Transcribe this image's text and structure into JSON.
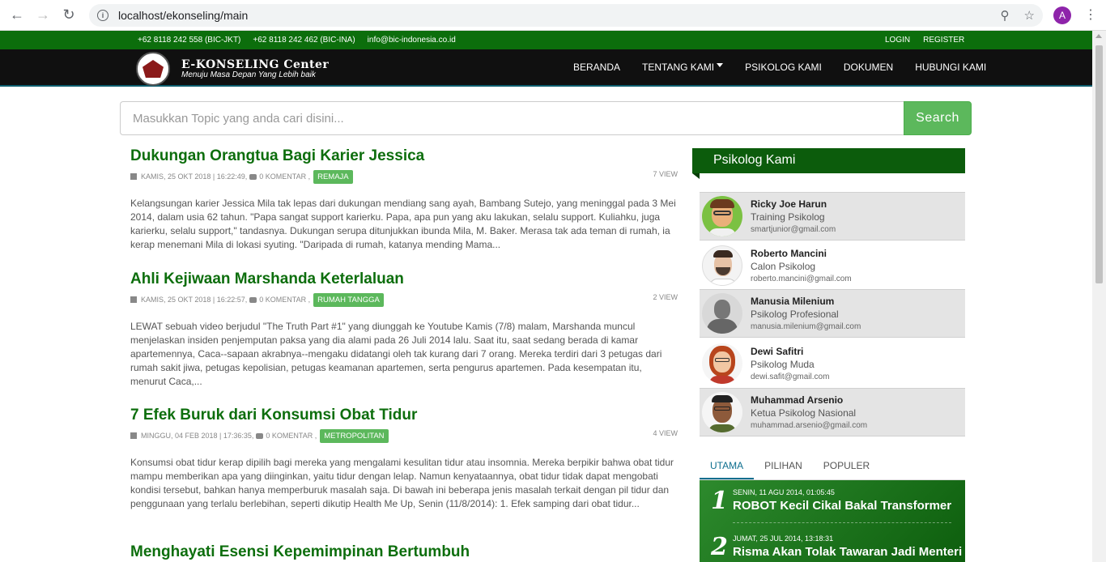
{
  "browser": {
    "url": "localhost/ekonseling/main",
    "avatar_letter": "A"
  },
  "topbar": {
    "contacts": [
      "+62 8118 242 558 (BIC-JKT)",
      "+62 8118 242 462 (BIC-INA)",
      "info@bic-indonesia.co.id"
    ],
    "login": "LOGIN",
    "register": "REGISTER"
  },
  "header": {
    "brand_title": "E-KONSELING Center",
    "brand_subtitle": "Menuju Masa Depan Yang Lebih baik",
    "nav": [
      "BERANDA",
      "TENTANG KAMI",
      "PSIKOLOG KAMI",
      "DOKUMEN",
      "HUBUNGI KAMI"
    ]
  },
  "search": {
    "placeholder": "Masukkan Topic yang anda cari disini...",
    "button": "Search"
  },
  "articles": [
    {
      "title": "Dukungan Orangtua Bagi Karier Jessica",
      "date": "KAMIS, 25 OKT 2018 | 16:22:49,",
      "comments": "0 KOMENTAR ,",
      "tag": "REMAJA",
      "views": "7 VIEW",
      "excerpt": "Kelangsungan karier Jessica Mila tak lepas dari dukungan mendiang sang ayah, Bambang Sutejo, yang meninggal pada 3 Mei 2014, dalam usia 62 tahun.  \"Papa sangat support karierku. Papa, apa pun yang aku lakukan, selalu support. Kuliahku, juga karierku, selalu support,\" tandasnya.  Dukungan serupa ditunjukkan ibunda Mila, M. Baker. Merasa tak ada teman di rumah, ia kerap menemani Mila di lokasi syuting.  \"Daripada di rumah, katanya mending Mama..."
    },
    {
      "title": "Ahli Kejiwaan Marshanda Keterlaluan",
      "date": "KAMIS, 25 OKT 2018 | 16:22:57,",
      "comments": "0 KOMENTAR ,",
      "tag": "RUMAH TANGGA",
      "views": "2 VIEW",
      "excerpt": "LEWAT sebuah video berjudul \"The Truth Part #1\" yang diunggah ke Youtube Kamis (7/8) malam, Marshanda muncul menjelaskan insiden penjemputan paksa yang dia alami pada 26 Juli 2014 lalu. Saat itu, saat sedang berada di kamar apartemennya, Caca--sapaan akrabnya--mengaku didatangi oleh tak kurang dari 7 orang. Mereka terdiri dari 3 petugas dari rumah sakit jiwa, petugas kepolisian, petugas keamanan apartemen, serta pengurus apartemen. Pada kesempatan itu, menurut Caca,..."
    },
    {
      "title": "7 Efek Buruk dari Konsumsi Obat Tidur",
      "date": "MINGGU, 04 FEB 2018 | 17:36:35,",
      "comments": "0 KOMENTAR ,",
      "tag": "METROPOLITAN",
      "views": "4 VIEW",
      "excerpt": "Konsumsi obat tidur kerap dipilih bagi mereka yang mengalami kesulitan tidur atau insomnia. Mereka berpikir bahwa obat tidur mampu memberikan apa yang diinginkan, yaitu tidur dengan lelap. Namun kenyataannya, obat tidur tidak dapat mengobati kondisi tersebut, bahkan hanya memperburuk masalah saja.  Di bawah ini beberapa jenis masalah terkait dengan pil tidur dan penggunaan yang terlalu berlebihan, seperti dikutip Health Me Up, Senin (11/8/2014): 1. Efek samping dari obat tidur..."
    },
    {
      "title": "Menghayati Esensi Kepemimpinan Bertumbuh"
    }
  ],
  "sidebar": {
    "heading": "Psikolog Kami",
    "psychologists": [
      {
        "name": "Ricky Joe Harun",
        "role": "Training Psikolog",
        "email": "smartjunior@gmail.com"
      },
      {
        "name": "Roberto Mancini",
        "role": "Calon Psikolog",
        "email": "roberto.mancini@gmail.com"
      },
      {
        "name": "Manusia Milenium",
        "role": "Psikolog Profesional",
        "email": "manusia.milenium@gmail.com"
      },
      {
        "name": "Dewi Safitri",
        "role": "Psikolog Muda",
        "email": "dewi.safit@gmail.com"
      },
      {
        "name": "Muhammad Arsenio",
        "role": "Ketua Psikolog Nasional",
        "email": "muhammad.arsenio@gmail.com"
      }
    ],
    "tabs": [
      "UTAMA",
      "PILIHAN",
      "POPULER"
    ],
    "popular": [
      {
        "num": "1",
        "date": "SENIN, 11 AGU 2014, 01:05:45",
        "title": "ROBOT Kecil Cikal Bakal Transformer"
      },
      {
        "num": "2",
        "date": "JUMAT, 25 JUL 2014, 13:18:31",
        "title": "Risma Akan Tolak Tawaran Jadi Menteri"
      }
    ]
  }
}
